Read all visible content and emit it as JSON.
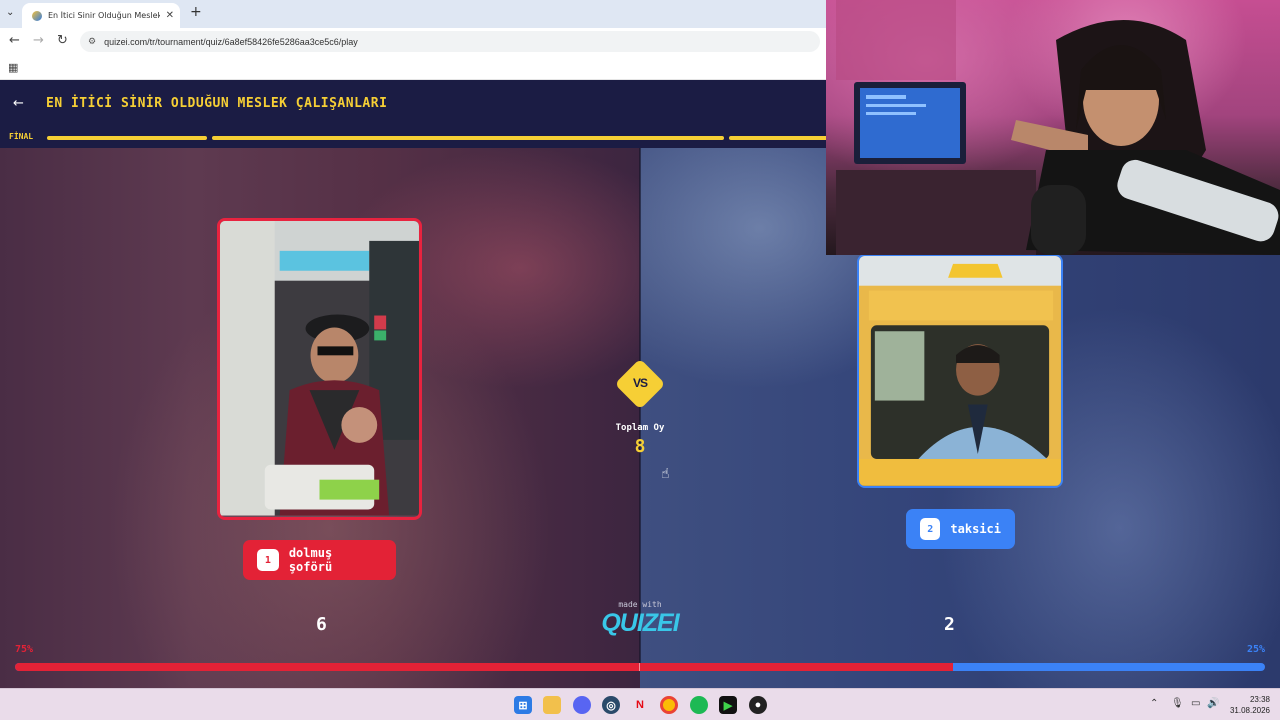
{
  "browser": {
    "tab_title": "En İtici Sinir Olduğun Meslek Ç",
    "url": "quizei.com/tr/tournament/quiz/6a8ef58426fe5286aa3ce5c6/play"
  },
  "quiz": {
    "title": "EN İTİCİ SİNİR OLDUĞUN MESLEK ÇALIŞANLARI",
    "round_label": "FİNAL",
    "vs_label": "VS",
    "total_label": "Toplam Oy",
    "total_votes": "8",
    "made_with": "made with",
    "logo_text": "QUIZEI",
    "left": {
      "index": "1",
      "name": "dolmuş şoförü",
      "votes": "6",
      "percent": "75%"
    },
    "right": {
      "index": "2",
      "name": "taksici",
      "votes": "2",
      "percent": "25%"
    },
    "vote_share_left": 0.75
  },
  "taskbar": {
    "time": "23:38",
    "date": "31.08.2026",
    "icons": [
      "windows-start-icon",
      "file-explorer-icon",
      "discord-icon",
      "app-icon",
      "netflix-icon",
      "chrome-icon",
      "spotify-icon",
      "terminal-icon",
      "steam-icon"
    ]
  },
  "colors": {
    "accent_yellow": "#f6cf35",
    "left_red": "#e32236",
    "right_blue": "#3b82f6",
    "header_navy": "#1b1c44"
  }
}
